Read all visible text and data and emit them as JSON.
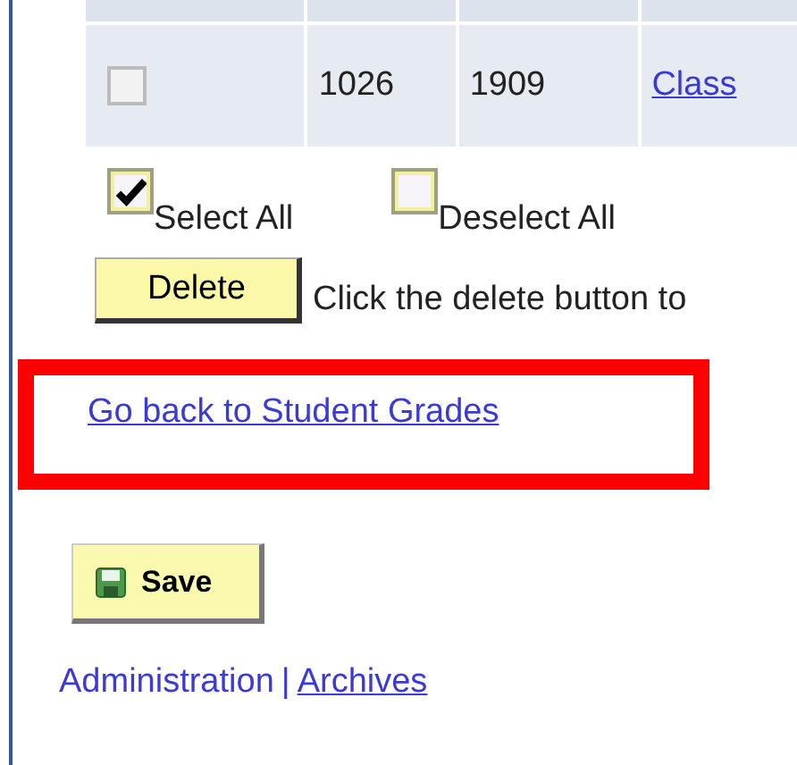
{
  "table": {
    "rows": [
      {
        "checked": false,
        "cells": [
          "1026",
          "1909"
        ],
        "link": "Class"
      }
    ]
  },
  "select_all": {
    "label": "Select All",
    "checked": true
  },
  "deselect_all": {
    "label": "Deselect All",
    "checked": false
  },
  "delete_button": "Delete",
  "delete_hint": "Click the delete button to",
  "back_link": "Go back to Student Grades",
  "save_button": "Save",
  "footer": {
    "administration": "Administration",
    "separator": "|",
    "archives": "Archives"
  }
}
